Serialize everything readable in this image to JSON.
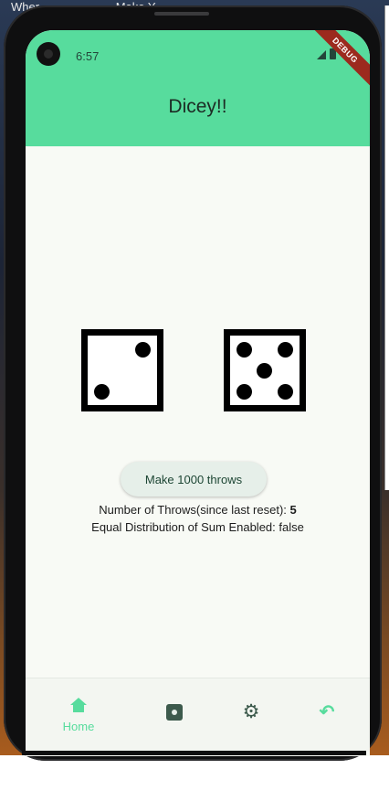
{
  "desktop": {
    "title_fragments": [
      "Wher",
      "Make Y"
    ]
  },
  "status_bar": {
    "time": "6:57",
    "debug_label": "DEBUG"
  },
  "app_bar": {
    "title": "Dicey!!",
    "color": "#57dc9d"
  },
  "dice": [
    {
      "value": 2
    },
    {
      "value": 5
    }
  ],
  "action_button": {
    "label": "Make 1000 throws"
  },
  "stats": {
    "throws_label": "Number of Throws(since last reset): ",
    "throws_value": "5",
    "distribution_text": "Equal Distribution of Sum Enabled: false"
  },
  "bottom_nav": {
    "items": [
      {
        "icon": "home-icon",
        "label": "Home",
        "selected": true
      },
      {
        "icon": "dice-icon",
        "label": "",
        "selected": false
      },
      {
        "icon": "gear-icon",
        "label": "",
        "selected": false
      },
      {
        "icon": "undo-icon",
        "label": "",
        "selected": false
      }
    ]
  }
}
